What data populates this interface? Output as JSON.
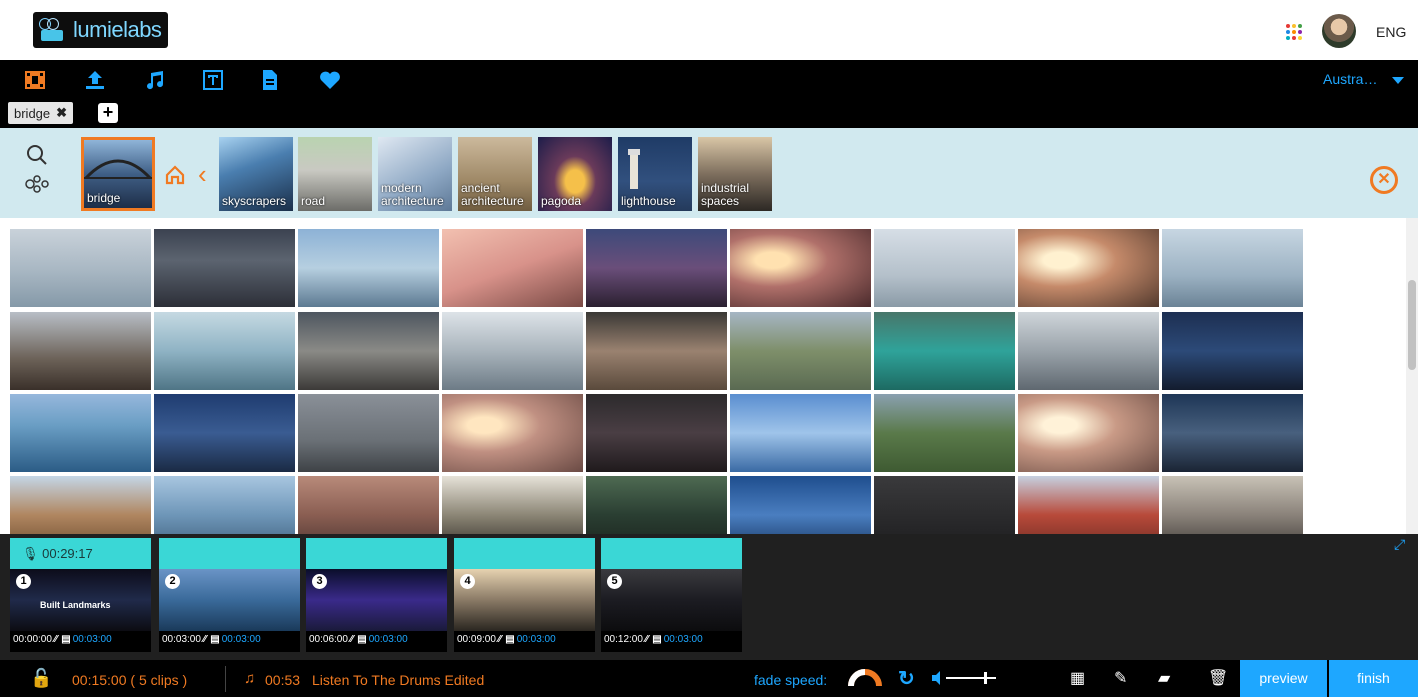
{
  "header": {
    "logo_text": "lumielabs",
    "language": "ENG",
    "apps_icon": "apps-grid-icon",
    "avatar": "user-avatar"
  },
  "toolbar": {
    "tools": [
      "film-icon",
      "upload-icon",
      "music-icon",
      "text-icon",
      "document-icon",
      "heart-icon"
    ],
    "region": "Austra…",
    "tab": {
      "label": "bridge",
      "close": "✖"
    },
    "add_tab": "+"
  },
  "keywords": {
    "selected": "bridge",
    "related": [
      {
        "label": "skyscrapers"
      },
      {
        "label": "road"
      },
      {
        "label": "modern architecture"
      },
      {
        "label": "ancient architecture"
      },
      {
        "label": "pagoda"
      },
      {
        "label": "lighthouse"
      },
      {
        "label": "industrial spaces"
      }
    ]
  },
  "gallery": {
    "rows": 4,
    "columns": 9
  },
  "timeline": {
    "total_duration": "00:29:17",
    "clips": [
      {
        "num": "1",
        "start": "00:00:00",
        "length": "00:03:00",
        "overlay": "Built Landmarks"
      },
      {
        "num": "2",
        "start": "00:03:00",
        "length": "00:03:00",
        "overlay": ""
      },
      {
        "num": "3",
        "start": "00:06:00",
        "length": "00:03:00",
        "overlay": ""
      },
      {
        "num": "4",
        "start": "00:09:00",
        "length": "00:03:00",
        "overlay": ""
      },
      {
        "num": "5",
        "start": "00:12:00",
        "length": "00:03:00",
        "overlay": ""
      }
    ]
  },
  "bottombar": {
    "total": "00:15:00   ( 5 clips )",
    "music_time": "00:53",
    "music_title": "Listen To The Drums Edited",
    "fade_label": "fade speed:",
    "preview": "preview",
    "finish": "finish"
  },
  "colors": {
    "accent_blue": "#1ea7ff",
    "accent_orange": "#f07a22",
    "clip_bar": "#3ad7d6",
    "keyword_bg": "#d1e9ef"
  }
}
